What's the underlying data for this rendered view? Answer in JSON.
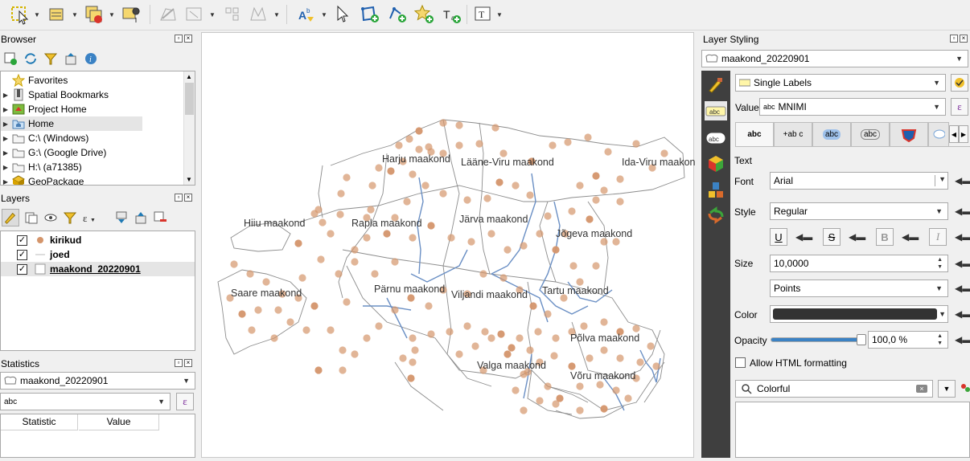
{
  "browser": {
    "title": "Browser",
    "items": [
      {
        "label": "Favorites"
      },
      {
        "label": "Spatial Bookmarks"
      },
      {
        "label": "Project Home"
      },
      {
        "label": "Home"
      },
      {
        "label": "C:\\ (Windows)"
      },
      {
        "label": "G:\\ (Google Drive)"
      },
      {
        "label": "H:\\ (a71385)"
      },
      {
        "label": "GeoPackage"
      }
    ]
  },
  "layers": {
    "title": "Layers",
    "items": [
      {
        "label": "kirikud",
        "checked": true
      },
      {
        "label": "joed",
        "checked": true
      },
      {
        "label": "maakond_20220901",
        "checked": true
      }
    ]
  },
  "statistics": {
    "title": "Statistics",
    "layer": "maakond_20220901",
    "field": "abc",
    "columns": [
      "Statistic",
      "Value"
    ]
  },
  "map": {
    "labels": [
      "Harju maakond",
      "Lääne-Viru maakond",
      "Ida-Viru maakond",
      "Hiiu maakond",
      "Rapla maakond",
      "Järva maakond",
      "Jõgeva maakond",
      "Saare maakond",
      "Pärnu maakond",
      "Viljandi maakond",
      "Tartu maakond",
      "Põlva maakond",
      "Valga maakond",
      "Võru maakond"
    ],
    "colors": {
      "points": "#d4956b",
      "rivers": "#6a8fc4",
      "borders": "#8c8c8c"
    }
  },
  "styling": {
    "title": "Layer Styling",
    "layer": "maakond_20220901",
    "label_mode": "Single Labels",
    "value_label": "Value",
    "value": "MNIMI",
    "section": "Text",
    "font_label": "Font",
    "font": "Arial",
    "style_label": "Style",
    "style": "Regular",
    "size_label": "Size",
    "size": "10,0000",
    "unit": "Points",
    "color_label": "Color",
    "color_value": "#333333",
    "opacity_label": "Opacity",
    "opacity": "100,0 %",
    "opacity_fraction": 1.0,
    "html_label": "Allow HTML formatting",
    "search": "Colorful",
    "format_buttons": [
      "U",
      "S",
      "B",
      "I"
    ]
  }
}
